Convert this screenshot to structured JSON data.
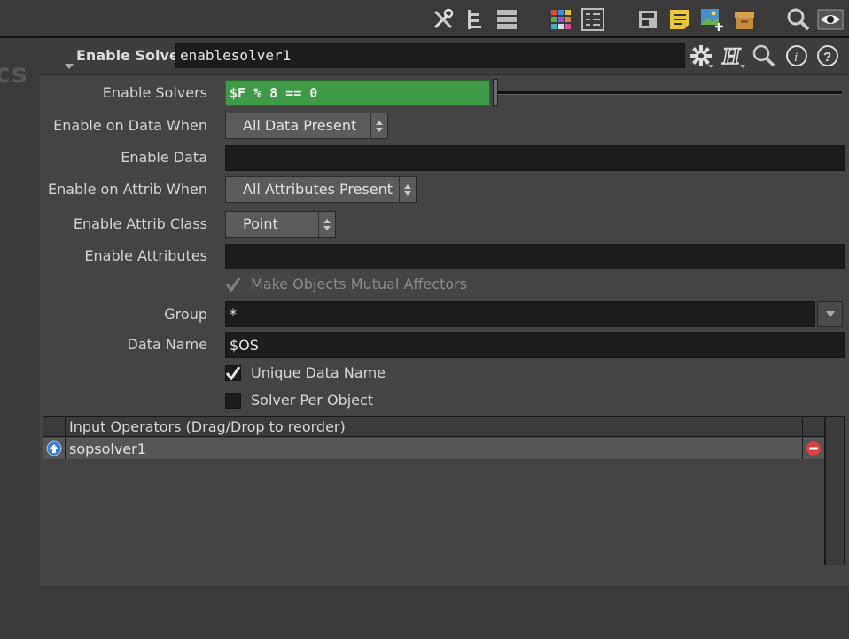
{
  "toolbar": {
    "icons": [
      "tools-icon",
      "tree-icon",
      "list-icon",
      "color-grid-icon",
      "parameter-list-icon",
      "network-layout-icon",
      "sticky-note-icon",
      "image-add-icon",
      "package-icon",
      "search-icon",
      "eye-icon"
    ]
  },
  "left_strip": {
    "partial_text": "cs"
  },
  "header": {
    "label": "Enable Solver",
    "node_name": "enablesolver1",
    "icons": [
      "gear-icon",
      "houdini-help-icon",
      "search-icon",
      "info-icon",
      "help-icon"
    ]
  },
  "params": {
    "enable_solvers": {
      "label": "Enable Solvers",
      "value": "$F % 8 == 0",
      "color": "#3e9a46"
    },
    "enable_on_data_when": {
      "label": "Enable on Data When",
      "value": "All Data Present"
    },
    "enable_data": {
      "label": "Enable Data",
      "value": ""
    },
    "enable_on_attrib_when": {
      "label": "Enable on Attrib When",
      "value": "All Attributes Present"
    },
    "enable_attrib_class": {
      "label": "Enable Attrib Class",
      "value": "Point"
    },
    "enable_attributes": {
      "label": "Enable Attributes",
      "value": ""
    },
    "mutual_affectors": {
      "label": "Make Objects Mutual Affectors",
      "checked": true,
      "disabled": true
    },
    "group": {
      "label": "Group",
      "value": "*"
    },
    "data_name": {
      "label": "Data Name",
      "value": "$OS"
    },
    "unique_data_name": {
      "label": "Unique Data Name",
      "checked": true
    },
    "solver_per_object": {
      "label": "Solver Per Object",
      "checked": false
    }
  },
  "input_list": {
    "header": "Input Operators (Drag/Drop to reorder)",
    "rows": [
      {
        "name": "sopsolver1"
      }
    ]
  }
}
